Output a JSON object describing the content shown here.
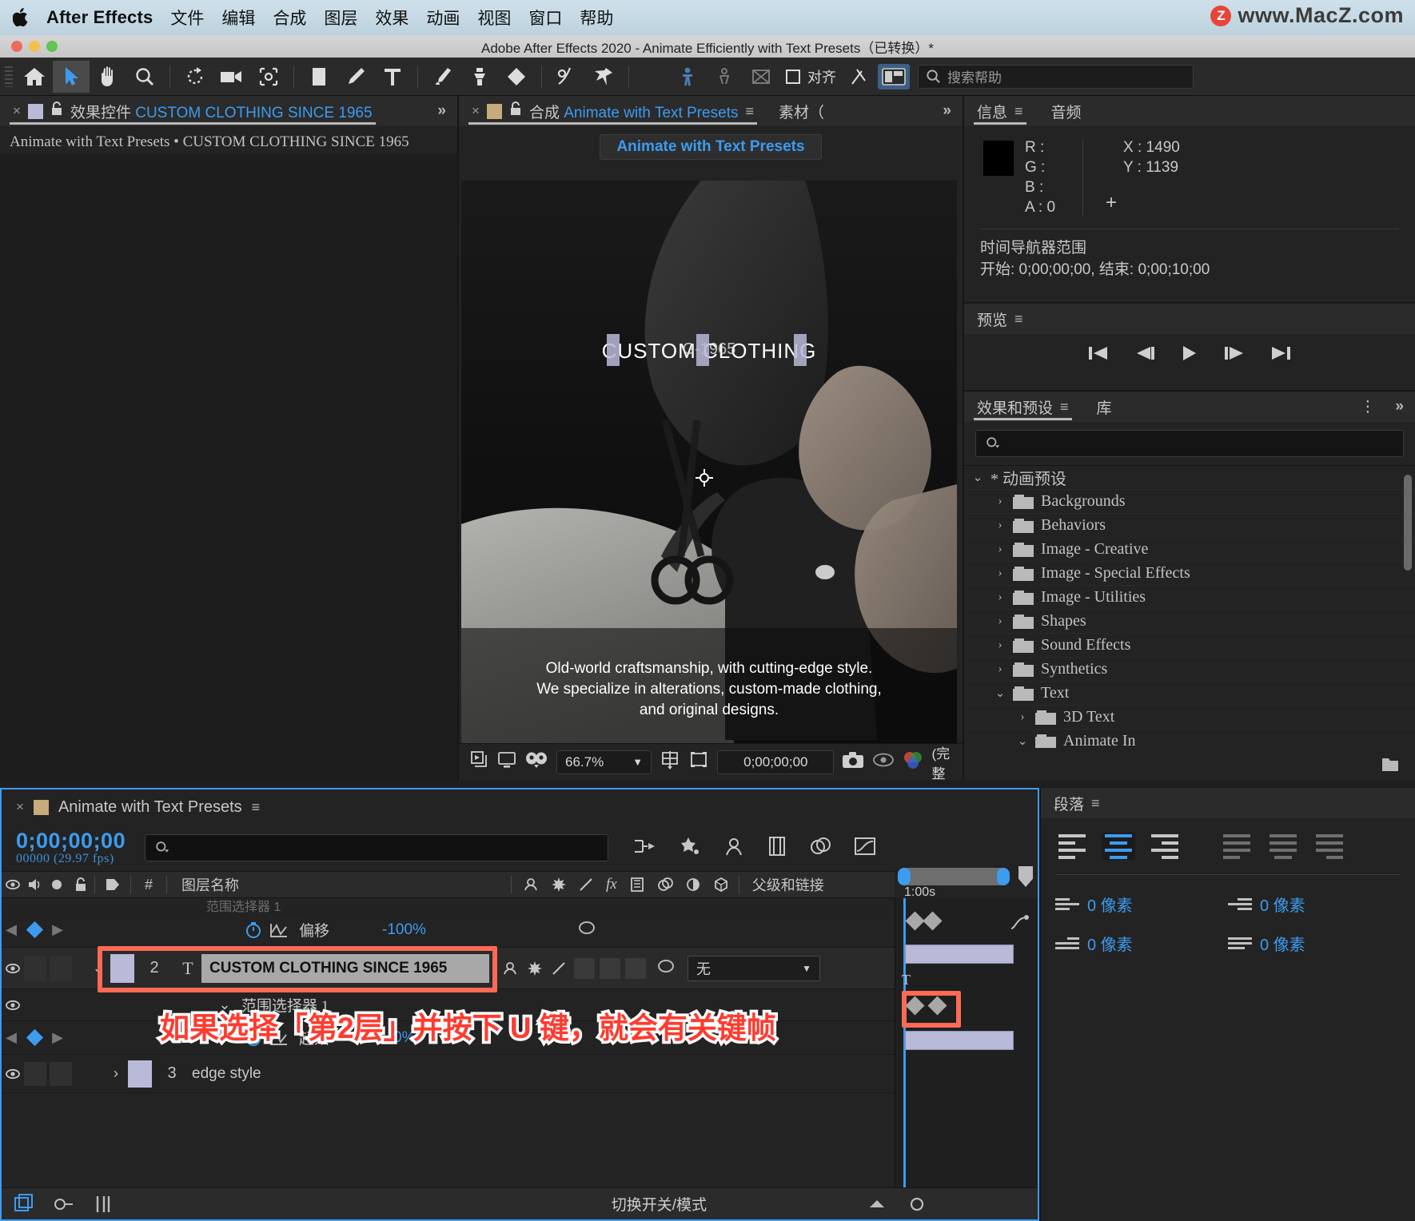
{
  "mac_menu": {
    "app_name": "After Effects",
    "items": [
      "文件",
      "编辑",
      "合成",
      "图层",
      "效果",
      "动画",
      "视图",
      "窗口",
      "帮助"
    ],
    "watermark_badge": "Z",
    "watermark": "www.MacZ.com"
  },
  "window": {
    "title": "Adobe After Effects 2020 - Animate Efficiently with Text Presets（已转换）*"
  },
  "toolbar": {
    "align_label": "对齐",
    "search_placeholder": "搜索帮助"
  },
  "effect_controls": {
    "close": "×",
    "tab_label": "效果控件",
    "tab_target": "CUSTOM CLOTHING  SINCE 1965",
    "expand": "»",
    "subtitle": "Animate with Text Presets • CUSTOM CLOTHING  SINCE 1965"
  },
  "composition": {
    "close": "×",
    "tab_label": "合成",
    "tab_target": "Animate with Text Presets",
    "tab_menu": "≡",
    "footage_tab": "素材",
    "footage_paren": "（",
    "expand": "»",
    "comp_name": "Animate with Text Presets",
    "viewer_text": "CUSTOM CLOTHING",
    "viewer_ghost": "G-1965",
    "caption_lines": [
      "Old-world craftsmanship, with cutting-edge style.",
      "We specialize in alterations, custom-made clothing,",
      "and original designs."
    ],
    "toolbar": {
      "zoom": "66.7%",
      "timecode": "0;00;00;00",
      "quality": "(完整"
    }
  },
  "info": {
    "tab_label": "信息",
    "tab_menu": "≡",
    "audio_tab": "音频",
    "r_label": "R :",
    "g_label": "G :",
    "b_label": "B :",
    "a_label": "A :  0",
    "x_label": "X : 1490",
    "y_label": "Y : 1139",
    "cursor": "+",
    "range_title": "时间导航器范围",
    "range_value": "开始: 0;00;00;00,  结束: 0;00;10;00"
  },
  "preview": {
    "tab_label": "预览",
    "tab_menu": "≡",
    "buttons": [
      "first-frame-icon",
      "prev-frame-icon",
      "play-icon",
      "next-frame-icon",
      "last-frame-icon"
    ]
  },
  "effects_presets": {
    "tab_label": "效果和预设",
    "tab_menu": "≡",
    "library_tab": "库",
    "more": "⋮",
    "expand": "»",
    "search_placeholder": "",
    "root": "* 动画预设",
    "items": [
      {
        "label": "Backgrounds",
        "expanded": false,
        "indent": 1
      },
      {
        "label": "Behaviors",
        "expanded": false,
        "indent": 1
      },
      {
        "label": "Image - Creative",
        "expanded": false,
        "indent": 1
      },
      {
        "label": "Image - Special Effects",
        "expanded": false,
        "indent": 1
      },
      {
        "label": "Image - Utilities",
        "expanded": false,
        "indent": 1
      },
      {
        "label": "Shapes",
        "expanded": false,
        "indent": 1
      },
      {
        "label": "Sound Effects",
        "expanded": false,
        "indent": 1
      },
      {
        "label": "Synthetics",
        "expanded": false,
        "indent": 1
      },
      {
        "label": "Text",
        "expanded": true,
        "indent": 1
      },
      {
        "label": "3D Text",
        "expanded": false,
        "indent": 2
      },
      {
        "label": "Animate In",
        "expanded": true,
        "indent": 2
      }
    ]
  },
  "timeline": {
    "close": "×",
    "comp_name": "Animate with Text Presets",
    "menu": "≡",
    "timecode": "0;00;00;00",
    "frames": "00000 (29.97 fps)",
    "columns": {
      "hash": "#",
      "layer_name": "图层名称",
      "parent": "父级和链接"
    },
    "ruler_label": "1:00s",
    "rows": [
      {
        "type": "property",
        "label": "范围选择器 1",
        "value": "",
        "faded": true
      },
      {
        "type": "property",
        "label": "偏移",
        "value": "-100%",
        "keyframe": true
      },
      {
        "type": "layer",
        "index": "2",
        "name": "CUSTOM CLOTHING  SINCE 1965",
        "parent": "无",
        "selected": true
      },
      {
        "type": "property",
        "label": "范围选择器 1",
        "value": ""
      },
      {
        "type": "property",
        "label": "起始",
        "value": "0%",
        "keyframe": true
      },
      {
        "type": "layer",
        "index": "3",
        "name": "edge style",
        "parent": ""
      }
    ],
    "footer": "切换开关/模式",
    "annotation": "如果选择「第2层」并按下 U 键，就会有关键帧"
  },
  "paragraph": {
    "tab_label": "段落",
    "tab_menu": "≡",
    "align_selected_index": 1,
    "indents": [
      {
        "icon": "indent-left-icon",
        "value": "0 像素"
      },
      {
        "icon": "indent-right-icon",
        "value": "0 像素"
      },
      {
        "icon": "indent-first-line-icon",
        "value": "0 像素"
      },
      {
        "icon": "space-before-icon",
        "value": "0 像素"
      }
    ]
  },
  "colors": {
    "accent_blue": "#3d9bf0",
    "panel_bg": "#232323",
    "annotation_red": "#ff3b2f",
    "layer_purple": "#b9b9d8"
  }
}
